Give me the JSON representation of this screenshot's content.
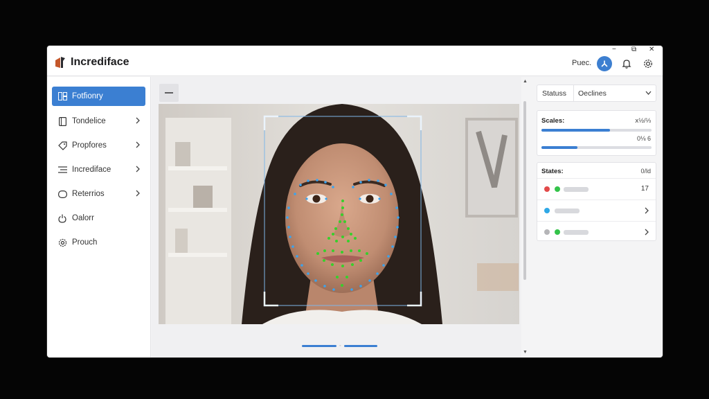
{
  "app": {
    "title": "Incrediface",
    "user": "Puec."
  },
  "window_controls": {
    "minimize": "−",
    "maximize": "⧉",
    "close": "✕"
  },
  "sidebar": {
    "items": [
      {
        "label": "Fotfionry",
        "icon": "grid-icon",
        "active": true
      },
      {
        "label": "Tondelice",
        "icon": "tablet-icon",
        "chevron": true
      },
      {
        "label": "Propfores",
        "icon": "tag-icon",
        "chevron": true
      },
      {
        "label": "Incrediface",
        "icon": "list-icon",
        "chevron": true
      },
      {
        "label": "Reterrios",
        "icon": "capsule-icon",
        "chevron": true
      },
      {
        "label": "Oalorr",
        "icon": "power-icon"
      },
      {
        "label": "Prouch",
        "icon": "settings-icon"
      }
    ]
  },
  "right_panel": {
    "dropdown": {
      "label": "Statuss",
      "value": "Oeclines"
    },
    "scores_card": {
      "title": "Scales:",
      "value": "ⅹ½/⅓",
      "bar1_fill": 0.62,
      "value2": "0⅛ 6",
      "bar2_fill": 0.33
    },
    "states_card": {
      "title": "States:",
      "value": "0/ld",
      "rows": [
        {
          "value": "17"
        },
        {
          "value": ""
        },
        {
          "value": ""
        }
      ]
    }
  },
  "colors": {
    "accent": "#3b7fd2",
    "landmark_blue": "#3aa3ee",
    "landmark_green": "#37d02b",
    "status_red": "#e24a4a",
    "status_green": "#34c34a",
    "status_cyan": "#2fa8e6",
    "status_gray": "#b5b5b8"
  }
}
